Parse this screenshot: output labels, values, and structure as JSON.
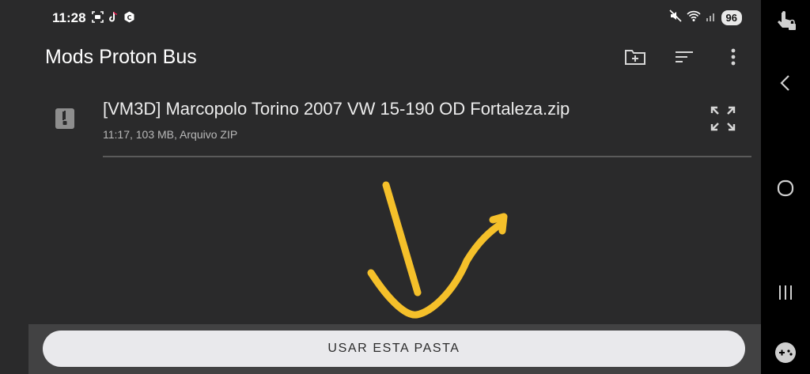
{
  "status_bar": {
    "time": "11:28",
    "battery": "96",
    "left_icons": [
      "screenshot-icon",
      "tiktok-icon",
      "app-icon"
    ],
    "right_icons": [
      "mute-icon",
      "wifi-icon",
      "signal-icon"
    ]
  },
  "app_bar": {
    "title": "Mods Proton Bus",
    "actions": [
      "new-folder-icon",
      "sort-icon",
      "more-vert-icon"
    ]
  },
  "file": {
    "name": "[VM3D] Marcopolo Torino 2007 VW 15-190 OD Fortaleza.zip",
    "meta": "11:17, 103 MB, Arquivo ZIP",
    "icon": "zip-file-icon"
  },
  "action_button": {
    "label": "USAR ESTA PASTA"
  },
  "annotation": {
    "color": "#f5c02a",
    "shape": "arrow-pointing-down"
  },
  "nav_bar": {
    "items": [
      "touch-lock-icon",
      "back-icon",
      "home-icon",
      "recents-icon",
      "game-controller-icon"
    ]
  },
  "colors": {
    "background": "#2a2a2b",
    "bottom_bar": "#424243",
    "button": "#e9e9ec",
    "accent_arrow": "#f5c02a"
  }
}
